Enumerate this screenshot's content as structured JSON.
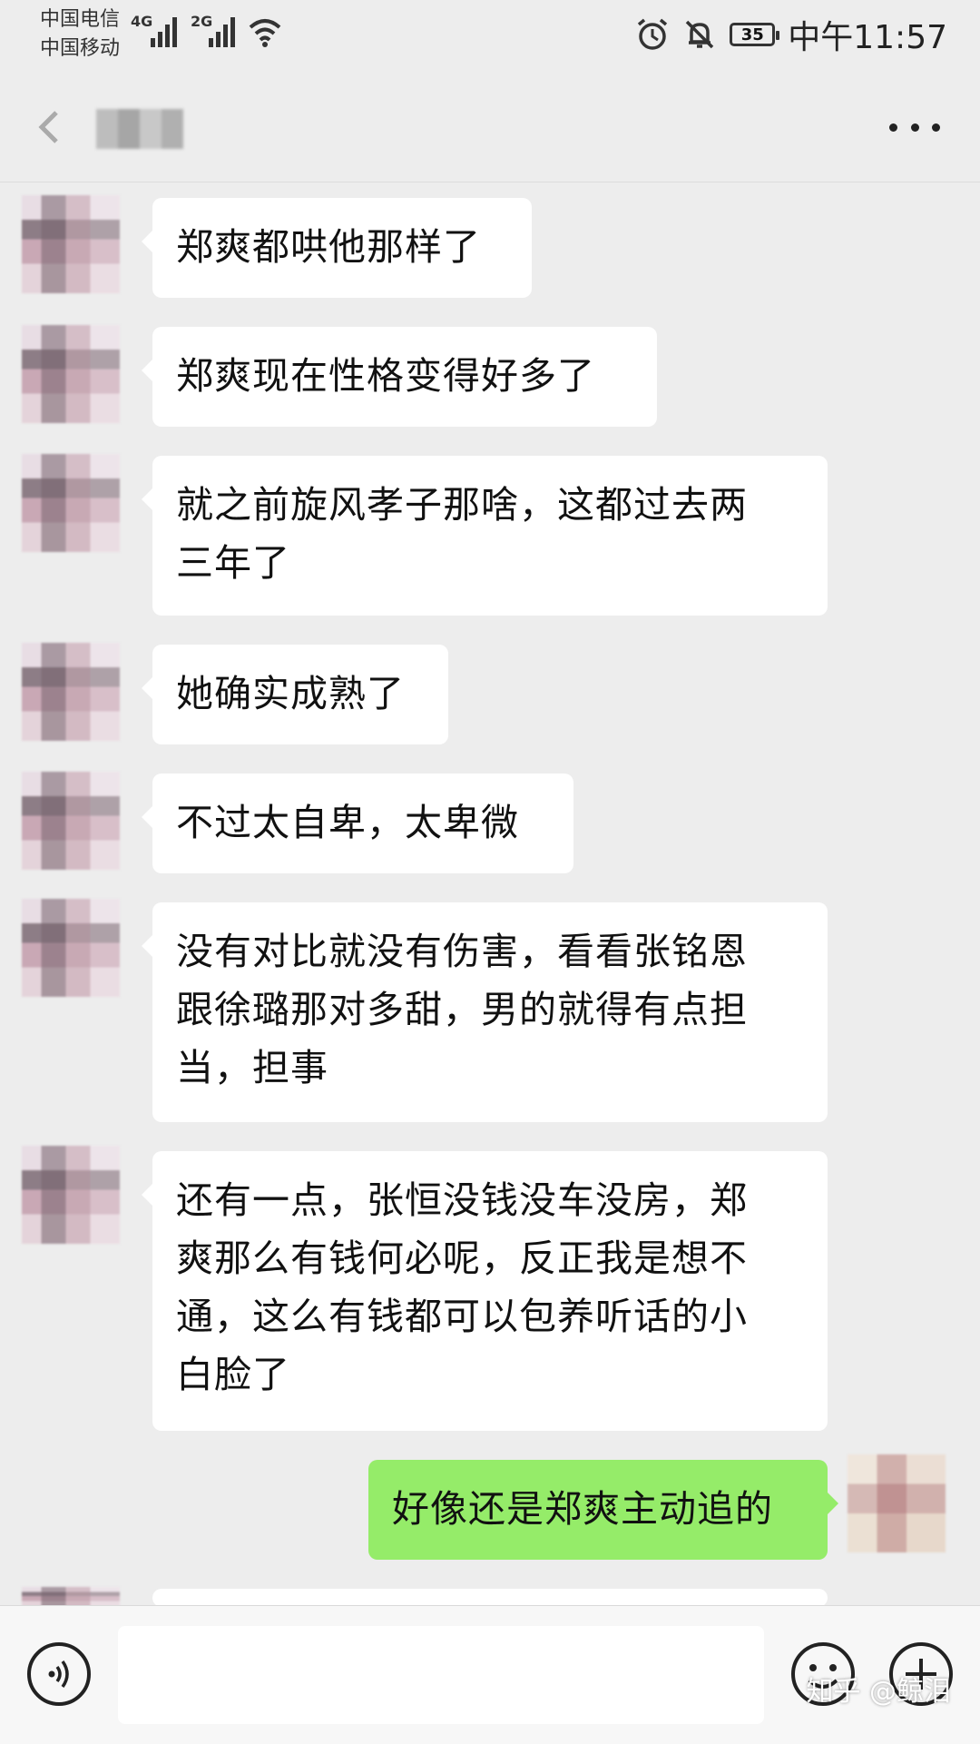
{
  "status_bar": {
    "carrier_1": "中国电信",
    "carrier_2": "中国移动",
    "network_1": "4G",
    "network_2": "2G",
    "battery": "35",
    "time": "中午11:57"
  },
  "icons": {
    "signal": "signal-bars-icon",
    "wifi": "wifi-icon",
    "alarm": "alarm-clock-icon",
    "mute": "bell-muted-icon",
    "back": "back-arrow-icon",
    "more": "more-dots-icon",
    "voice": "voice-icon",
    "emoji": "emoji-icon",
    "plus": "plus-icon"
  },
  "colors": {
    "background": "#ededed",
    "incoming_bubble": "#ffffff",
    "outgoing_bubble": "#95ec69"
  },
  "messages": [
    {
      "side": "left",
      "lines": [
        "郑爽都哄他那样了"
      ]
    },
    {
      "side": "left",
      "lines": [
        "郑爽现在性格变得好多了"
      ]
    },
    {
      "side": "left",
      "lines": [
        "就之前旋风孝子那啥，这都过去两",
        "三年了"
      ]
    },
    {
      "side": "left",
      "lines": [
        "她确实成熟了"
      ]
    },
    {
      "side": "left",
      "lines": [
        "不过太自卑，太卑微"
      ]
    },
    {
      "side": "left",
      "lines": [
        "没有对比就没有伤害，看看张铭恩",
        "跟徐璐那对多甜，男的就得有点担",
        "当，担事"
      ]
    },
    {
      "side": "left",
      "lines": [
        "还有一点，张恒没钱没车没房，郑",
        "爽那么有钱何必呢，反正我是想不",
        "通，这么有钱都可以包养听话的小",
        "白脸了"
      ]
    },
    {
      "side": "right",
      "lines": [
        "好像还是郑爽主动追的"
      ]
    }
  ],
  "input": {
    "value": ""
  },
  "watermark": "知乎 @鲸泪"
}
